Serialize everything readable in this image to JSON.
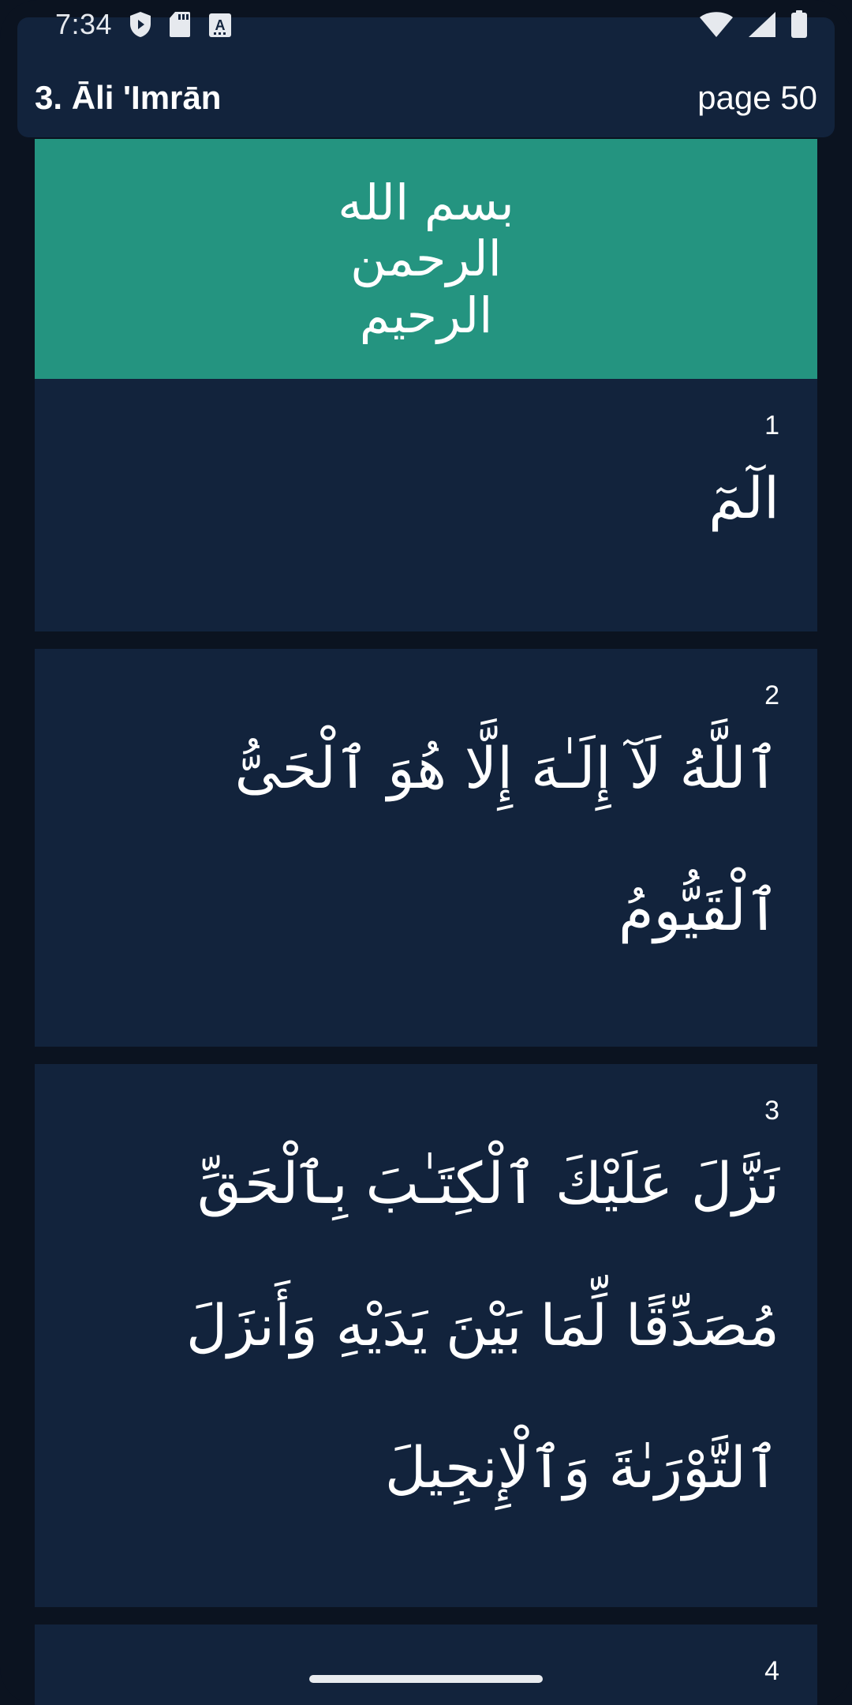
{
  "status_bar": {
    "time": "7:34",
    "icons_left": [
      "shield-play-icon",
      "sd-card-icon",
      "keyboard-a-icon"
    ],
    "icons_right": [
      "wifi-icon",
      "cell-signal-icon",
      "battery-icon"
    ]
  },
  "header": {
    "title": "3. Āli 'Imrān",
    "page": "page 50"
  },
  "bismillah": {
    "text": "بسم الله الرحمن الرحيم",
    "background": "#249480"
  },
  "verses": [
    {
      "number": "1",
      "text": "الٓمٓ"
    },
    {
      "number": "2",
      "text": "ٱللَّهُ لَآ إِلَـٰهَ إِلَّا هُوَ ٱلْحَىُّ ٱلْقَيُّومُ"
    },
    {
      "number": "3",
      "text": "نَزَّلَ عَلَيْكَ ٱلْكِتَـٰبَ بِٱلْحَقِّ مُصَدِّقًا لِّمَا بَيْنَ يَدَيْهِ وَأَنزَلَ ٱلتَّوْرَىٰةَ وَٱلْإِنجِيلَ"
    },
    {
      "number": "4",
      "text": ""
    }
  ],
  "colors": {
    "background": "#0b1320",
    "card": "#12233c",
    "accent": "#249480",
    "text": "#ffffff"
  }
}
